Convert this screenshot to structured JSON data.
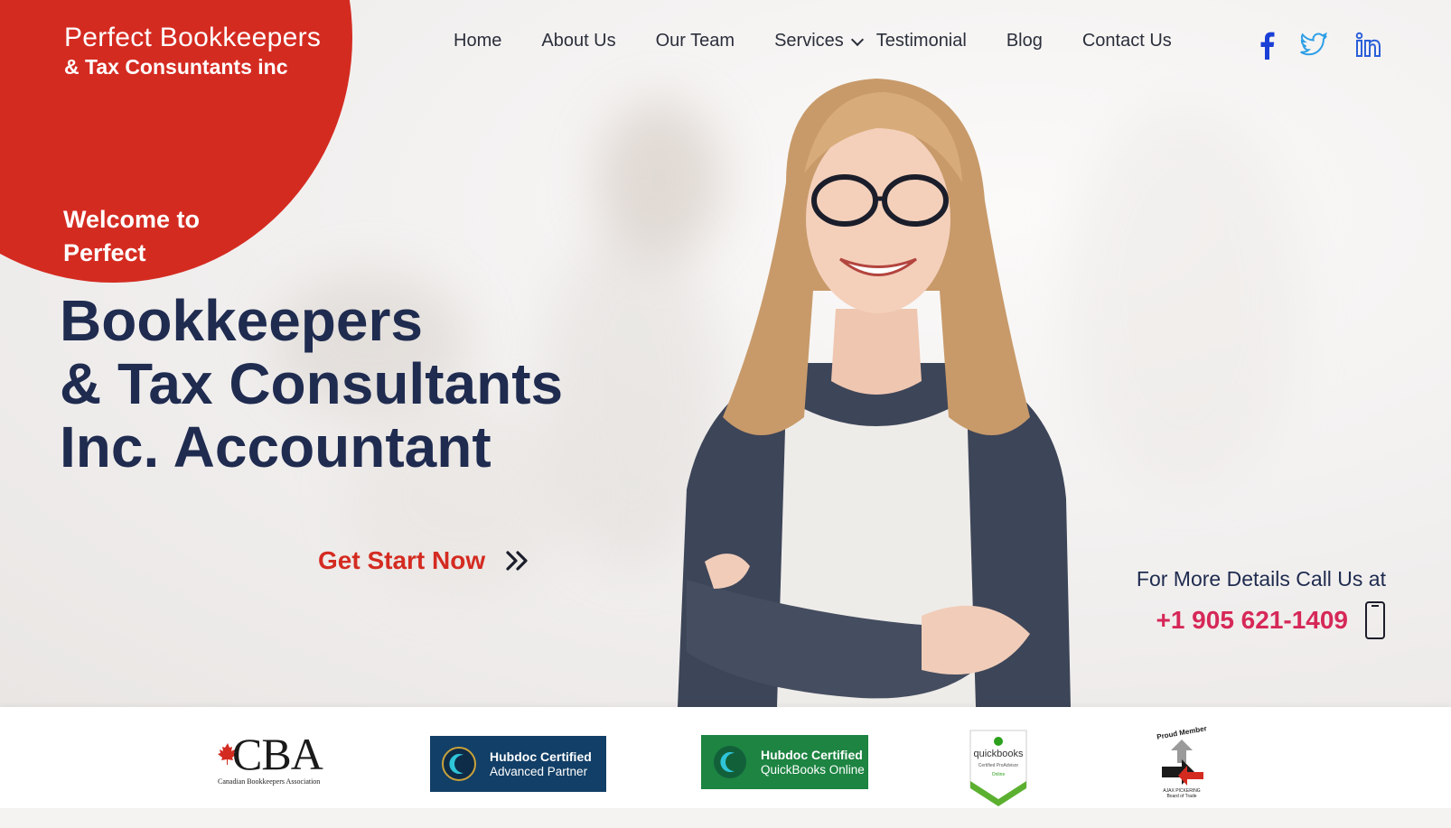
{
  "brand": {
    "line1": "Perfect Bookkeepers",
    "line2": "& Tax Consuntants inc",
    "accent_color": "#d42b21"
  },
  "nav": {
    "items": [
      {
        "label": "Home"
      },
      {
        "label": "About Us"
      },
      {
        "label": "Our Team"
      },
      {
        "label": "Services",
        "has_dropdown": true
      },
      {
        "label": "Testimonial"
      },
      {
        "label": "Blog"
      },
      {
        "label": "Contact Us"
      }
    ]
  },
  "social": {
    "icons": [
      "facebook-icon",
      "twitter-icon",
      "linkedin-icon"
    ],
    "facebook_color": "#1a3fd6",
    "twitter_color": "#2e9fe6",
    "linkedin_color": "#2b5fd9"
  },
  "hero": {
    "welcome": "Welcome to Perfect",
    "headline_line1": "Bookkeepers",
    "headline_line2": "& Tax Consultants",
    "headline_line3": "Inc. Accountant",
    "headline_color": "#1f2b4f",
    "cta_label": "Get Start Now"
  },
  "contact": {
    "label": "For More Details Call Us at",
    "phone": "+1 905 621-1409",
    "phone_color": "#d62858"
  },
  "logos": {
    "cba": {
      "name": "CBA",
      "subtitle": "Canadian Bookkeepers Association"
    },
    "hubdoc_partner": {
      "title": "Hubdoc Certified",
      "subtitle": "Advanced Partner"
    },
    "hubdoc_qbo": {
      "title": "Hubdoc Certified",
      "subtitle": "QuickBooks Online"
    },
    "quickbooks": {
      "name": "quickbooks",
      "subtitle": "Certified ProAdvisor",
      "tag": "Online"
    },
    "proud_member": {
      "top": "Proud Member",
      "bottom": "AJAX PICKERING Board of Trade"
    }
  }
}
